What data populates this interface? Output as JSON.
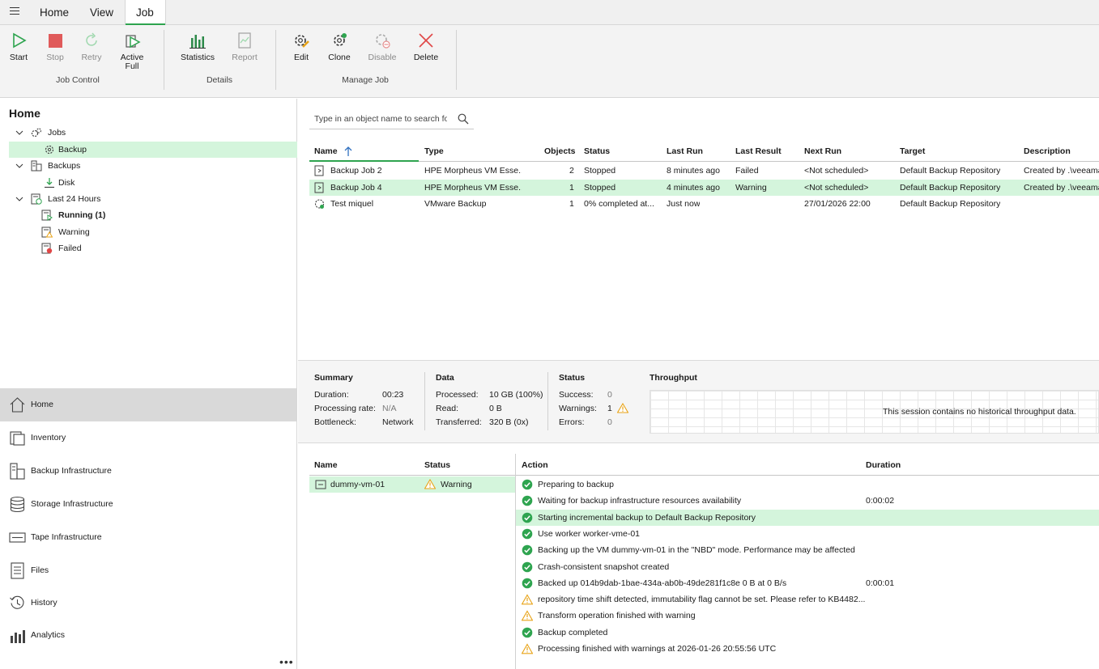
{
  "menu": {
    "tabs": [
      "Home",
      "View",
      "Job"
    ],
    "active_tab": "Job"
  },
  "ribbon": {
    "buttons": {
      "start": "Start",
      "stop": "Stop",
      "retry": "Retry",
      "active_full_1": "Active",
      "active_full_2": "Full",
      "statistics": "Statistics",
      "report": "Report",
      "edit": "Edit",
      "clone": "Clone",
      "disable": "Disable",
      "delete": "Delete"
    },
    "groups": {
      "job_control": "Job Control",
      "details": "Details",
      "manage_job": "Manage Job"
    }
  },
  "left": {
    "title": "Home",
    "tree": [
      {
        "label": "Jobs",
        "icon": "jobs-icon",
        "expanded": true
      },
      {
        "label": "Backup",
        "icon": "backup-job-icon",
        "selected": true
      },
      {
        "label": "Backups",
        "icon": "backups-icon",
        "expanded": true
      },
      {
        "label": "Disk",
        "icon": "disk-icon"
      },
      {
        "label": "Last 24 Hours",
        "icon": "last-24-hours-icon",
        "expanded": true
      },
      {
        "label": "Running (1)",
        "icon": "running-icon",
        "bold": true
      },
      {
        "label": "Warning",
        "icon": "warning-session-icon"
      },
      {
        "label": "Failed",
        "icon": "failed-session-icon"
      }
    ],
    "nav": [
      {
        "label": "Home",
        "icon": "home-icon",
        "active": true
      },
      {
        "label": "Inventory",
        "icon": "inventory-icon"
      },
      {
        "label": "Backup Infrastructure",
        "icon": "backup-infrastructure-icon"
      },
      {
        "label": "Storage Infrastructure",
        "icon": "storage-infrastructure-icon"
      },
      {
        "label": "Tape Infrastructure",
        "icon": "tape-infrastructure-icon"
      },
      {
        "label": "Files",
        "icon": "files-icon"
      },
      {
        "label": "History",
        "icon": "history-icon"
      },
      {
        "label": "Analytics",
        "icon": "analytics-icon"
      }
    ],
    "more": "•••"
  },
  "search": {
    "placeholder": "Type in an object name to search for"
  },
  "jobs": {
    "columns": [
      "Name",
      "Type",
      "Objects",
      "Status",
      "Last Run",
      "Last Result",
      "Next Run",
      "Target",
      "Description"
    ],
    "rows": [
      {
        "name": "Backup Job 2",
        "type": "HPE Morpheus VM Esse...",
        "objects": "2",
        "status": "Stopped",
        "last_run": "8 minutes ago",
        "last_result": "Failed",
        "next_run": "<Not scheduled>",
        "target": "Default Backup Repository",
        "description": "Created by .\\veeama"
      },
      {
        "name": "Backup Job 4",
        "type": "HPE Morpheus VM Esse...",
        "objects": "1",
        "status": "Stopped",
        "last_run": "4 minutes ago",
        "last_result": "Warning",
        "next_run": "<Not scheduled>",
        "target": "Default Backup Repository",
        "description": "Created by .\\veeama",
        "selected": true
      },
      {
        "name": "Test miquel",
        "type": "VMware Backup",
        "objects": "1",
        "status": "0% completed at...",
        "last_run": "Just now",
        "last_result": "",
        "next_run": "27/01/2026 22:00",
        "target": "Default Backup Repository",
        "description": ""
      }
    ]
  },
  "summary": {
    "summary": {
      "title": "Summary",
      "duration_l": "Duration:",
      "duration_v": "00:23",
      "rate_l": "Processing rate:",
      "rate_v": "N/A",
      "bottleneck_l": "Bottleneck:",
      "bottleneck_v": "Network"
    },
    "data": {
      "title": "Data",
      "processed_l": "Processed:",
      "processed_v": "10 GB (100%)",
      "read_l": "Read:",
      "read_v": "0 B",
      "transferred_l": "Transferred:",
      "transferred_v": "320 B (0x)"
    },
    "status": {
      "title": "Status",
      "success_l": "Success:",
      "success_v": "0",
      "warnings_l": "Warnings:",
      "warnings_v": "1",
      "errors_l": "Errors:",
      "errors_v": "0"
    },
    "throughput": {
      "title": "Throughput",
      "message": "This session contains no historical throughput data."
    }
  },
  "session": {
    "vm_columns": [
      "Name",
      "Status"
    ],
    "vm": {
      "name": "dummy-vm-01",
      "status": "Warning"
    },
    "action_columns": [
      "Action",
      "Duration"
    ],
    "actions": [
      {
        "text": "Preparing to backup",
        "level": "success",
        "duration": ""
      },
      {
        "text": "Waiting for backup infrastructure resources availability",
        "level": "success",
        "duration": "0:00:02"
      },
      {
        "text": "Starting incremental backup to Default Backup Repository",
        "level": "success",
        "duration": "",
        "selected": true
      },
      {
        "text": "Use worker worker-vme-01",
        "level": "success",
        "duration": ""
      },
      {
        "text": "Backing up the VM dummy-vm-01 in the \"NBD\" mode. Performance may be affected",
        "level": "success",
        "duration": ""
      },
      {
        "text": "Crash-consistent snapshot created",
        "level": "success",
        "duration": ""
      },
      {
        "text": "Backed up 014b9dab-1bae-434a-ab0b-49de281f1c8e 0 B at 0 B/s",
        "level": "success",
        "duration": "0:00:01"
      },
      {
        "text": "repository time shift detected, immutability flag cannot be set. Please refer to KB4482...",
        "level": "warning",
        "duration": ""
      },
      {
        "text": "Transform operation finished with warning",
        "level": "warning",
        "duration": ""
      },
      {
        "text": "Backup completed",
        "level": "success",
        "duration": ""
      },
      {
        "text": "Processing finished with warnings at 2026-01-26 20:55:56 UTC",
        "level": "warning",
        "duration": ""
      }
    ]
  },
  "colors": {
    "accent_green": "#2ea44f",
    "selection": "#d4f5dc",
    "warning": "#e8a317",
    "error": "#e04646"
  }
}
